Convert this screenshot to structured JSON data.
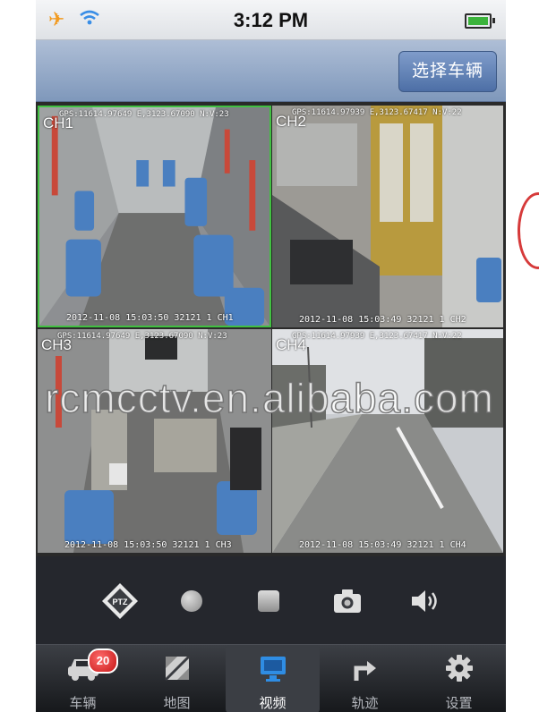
{
  "status_bar": {
    "time": "3:12 PM"
  },
  "navbar": {
    "select_vehicle": "选择车辆"
  },
  "channels": [
    {
      "label": "CH1",
      "gps": "GPS:11614.97649 E,3123.67090 N:V:23",
      "timestamp": "2012-11-08 15:03:50 32121 1 CH1"
    },
    {
      "label": "CH2",
      "gps": "GPS:11614.97939 E,3123.67417 N:V:22",
      "timestamp": "2012-11-08 15:03:49 32121 1 CH2"
    },
    {
      "label": "CH3",
      "gps": "GPS:11614.97649 E,3123.67090 N:V:23",
      "timestamp": "2012-11-08 15:03:50 32121 1 CH3"
    },
    {
      "label": "CH4",
      "gps": "GPS:11614.97939 E,3123.67417 N:V:22",
      "timestamp": "2012-11-08 15:03:49 32121 1 CH4"
    }
  ],
  "controls": {
    "ptz_label": "PTZ"
  },
  "tabbar": {
    "badge": "20",
    "tabs": [
      {
        "label": "车辆",
        "icon": "car-icon"
      },
      {
        "label": "地图",
        "icon": "map-icon"
      },
      {
        "label": "视频",
        "icon": "video-icon"
      },
      {
        "label": "轨迹",
        "icon": "track-icon"
      },
      {
        "label": "设置",
        "icon": "gear-icon"
      }
    ]
  },
  "watermark": "rcmcctv.en.alibaba.com",
  "colors": {
    "active_border": "#41c041",
    "badge": "#d81e1e",
    "active_tab_icon": "#2f8de4"
  }
}
